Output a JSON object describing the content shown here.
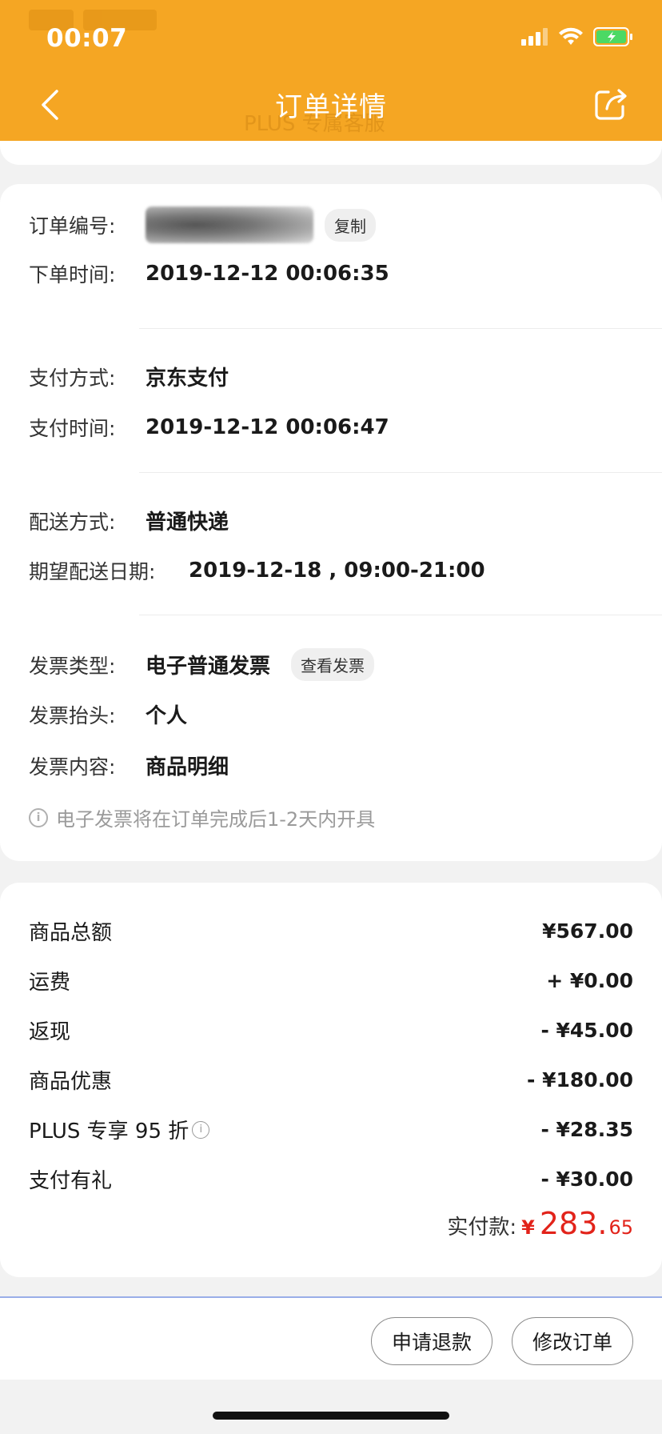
{
  "status_bar": {
    "time": "00:07"
  },
  "header": {
    "title": "订单详情",
    "ghost_text": "PLUS 专属客服"
  },
  "order": {
    "number_label": "订单编号:",
    "copy_label": "复制",
    "time_label": "下单时间:",
    "time_value": "2019-12-12 00:06:35"
  },
  "payment": {
    "method_label": "支付方式:",
    "method_value": "京东支付",
    "time_label": "支付时间:",
    "time_value": "2019-12-12 00:06:47"
  },
  "delivery": {
    "method_label": "配送方式:",
    "method_value": "普通快递",
    "date_label": "期望配送日期:",
    "date_value": "2019-12-18 , 09:00-21:00"
  },
  "invoice": {
    "type_label": "发票类型:",
    "type_value": "电子普通发票",
    "view_label": "查看发票",
    "title_label": "发票抬头:",
    "title_value": "个人",
    "content_label": "发票内容:",
    "content_value": "商品明细",
    "notice": "电子发票将在订单完成后1-2天内开具"
  },
  "price": {
    "rows": [
      {
        "label": "商品总额",
        "amount": "¥567.00"
      },
      {
        "label": "运费",
        "amount": "+ ¥0.00"
      },
      {
        "label": "返现",
        "amount": "- ¥45.00"
      },
      {
        "label": "商品优惠",
        "amount": "- ¥180.00"
      },
      {
        "label": "PLUS 专享 95 折",
        "amount": "- ¥28.35"
      },
      {
        "label": "支付有礼",
        "amount": "- ¥30.00"
      }
    ],
    "total_label": "实付款:",
    "total_currency": "¥",
    "total_integer": "283.",
    "total_decimal": "65"
  },
  "actions": {
    "refund_label": "申请退款",
    "modify_label": "修改订单"
  },
  "colors": {
    "header": "#f5a623",
    "price_red": "#e2231a"
  }
}
